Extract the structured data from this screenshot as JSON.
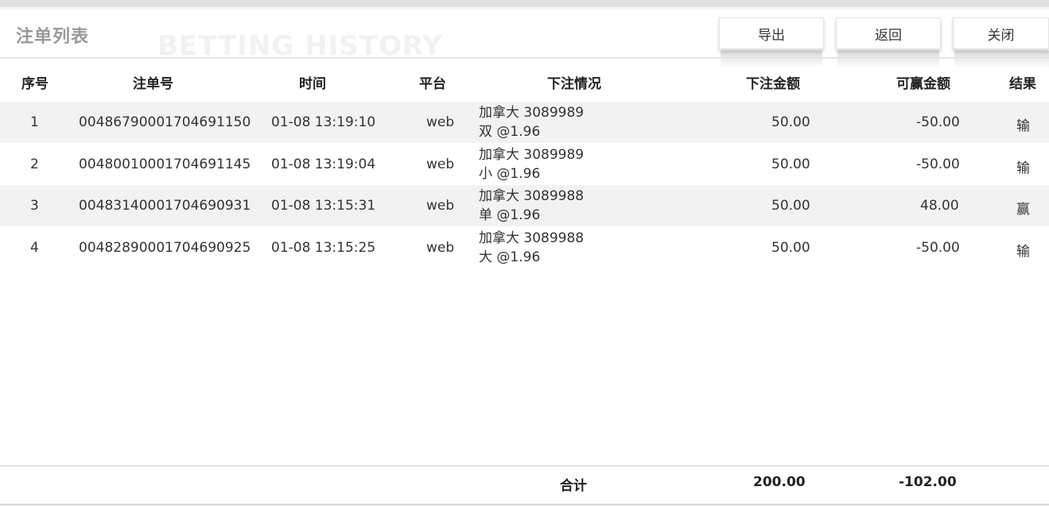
{
  "header": {
    "title": "注单列表",
    "watermark": "BETTING HISTORY",
    "buttons": {
      "export": "导出",
      "back": "返回",
      "close": "关闭"
    }
  },
  "table": {
    "columns": [
      "序号",
      "注单号",
      "时间",
      "平台",
      "下注情况",
      "下注金额",
      "可赢金额",
      "结果"
    ],
    "rows": [
      {
        "index": "1",
        "order_no": "00486790001704691150",
        "time": "01-08 13:19:10",
        "platform": "web",
        "detail_line1": "加拿大 3089989",
        "detail_line2": "双 @1.96",
        "bet_amount": "50.00",
        "win_amount": "-50.00",
        "result": "输"
      },
      {
        "index": "2",
        "order_no": "00480010001704691145",
        "time": "01-08 13:19:04",
        "platform": "web",
        "detail_line1": "加拿大 3089989",
        "detail_line2": "小 @1.96",
        "bet_amount": "50.00",
        "win_amount": "-50.00",
        "result": "输"
      },
      {
        "index": "3",
        "order_no": "00483140001704690931",
        "time": "01-08 13:15:31",
        "platform": "web",
        "detail_line1": "加拿大 3089988",
        "detail_line2": "单 @1.96",
        "bet_amount": "50.00",
        "win_amount": "48.00",
        "result": "赢"
      },
      {
        "index": "4",
        "order_no": "00482890001704690925",
        "time": "01-08 13:15:25",
        "platform": "web",
        "detail_line1": "加拿大 3089988",
        "detail_line2": "大 @1.96",
        "bet_amount": "50.00",
        "win_amount": "-50.00",
        "result": "输"
      }
    ]
  },
  "footer": {
    "label": "合计",
    "total_bet": "200.00",
    "total_win": "-102.00"
  }
}
